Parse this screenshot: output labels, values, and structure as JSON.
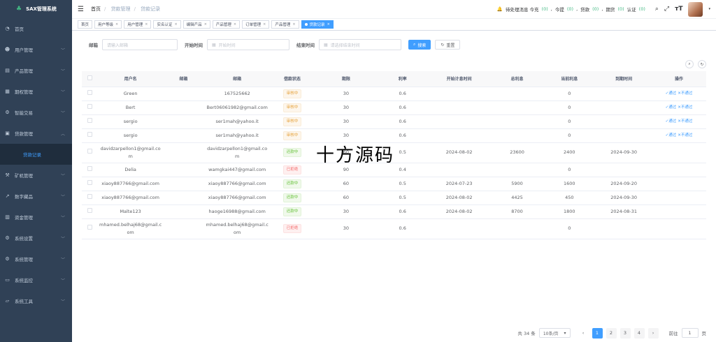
{
  "app": {
    "title": "SAX管理系统"
  },
  "sidebar": {
    "items": [
      {
        "label": "首页",
        "icon": "dashboard-icon",
        "glyph": "◔",
        "expandable": false
      },
      {
        "label": "用户管理",
        "icon": "user-icon",
        "glyph": "☻",
        "expandable": true
      },
      {
        "label": "产品管理",
        "icon": "document-icon",
        "glyph": "▤",
        "expandable": true
      },
      {
        "label": "期权管理",
        "icon": "chart-icon",
        "glyph": "▦",
        "expandable": true
      },
      {
        "label": "智能交易",
        "icon": "gear-icon",
        "glyph": "⚙",
        "expandable": true
      },
      {
        "label": "贷款管理",
        "icon": "cart-icon",
        "glyph": "▣",
        "expandable": true,
        "expanded": true
      },
      {
        "label": "贷款记录",
        "icon": "",
        "glyph": "",
        "expandable": false,
        "sub": true
      },
      {
        "label": "矿机管理",
        "icon": "tool-icon",
        "glyph": "⚒",
        "expandable": true
      },
      {
        "label": "数字藏品",
        "icon": "trend-icon",
        "glyph": "↗",
        "expandable": true
      },
      {
        "label": "资金管理",
        "icon": "wallet-icon",
        "glyph": "▥",
        "expandable": true
      },
      {
        "label": "系统设置",
        "icon": "settings-icon",
        "glyph": "⚙",
        "expandable": true
      },
      {
        "label": "系统管理",
        "icon": "system-icon",
        "glyph": "⚙",
        "expandable": true
      },
      {
        "label": "系统监控",
        "icon": "monitor-icon",
        "glyph": "▭",
        "expandable": true
      },
      {
        "label": "系统工具",
        "icon": "toolbox-icon",
        "glyph": "▱",
        "expandable": true
      }
    ]
  },
  "header": {
    "breadcrumb": [
      "首页",
      "贷款管理",
      "贷款记录"
    ],
    "pending_label": "待处理消息 今充",
    "counters": [
      {
        "label": "今充",
        "value": "(0)"
      },
      {
        "label": "今提",
        "value": "(0)"
      },
      {
        "label": "贷款",
        "value": "(0)"
      },
      {
        "label": "期货",
        "value": "(0)"
      },
      {
        "label": "认证",
        "value": "(0)"
      }
    ]
  },
  "tags": [
    {
      "label": "首页",
      "closable": false
    },
    {
      "label": "用户等级",
      "closable": true
    },
    {
      "label": "用户管理",
      "closable": true
    },
    {
      "label": "实名认证",
      "closable": true
    },
    {
      "label": "编辑产品",
      "closable": true
    },
    {
      "label": "产品管理",
      "closable": true
    },
    {
      "label": "订单管理",
      "closable": true
    },
    {
      "label": "产品管理",
      "closable": true
    },
    {
      "label": "贷款记录",
      "closable": true,
      "active": true
    }
  ],
  "search": {
    "email_label": "邮箱",
    "email_placeholder": "请输入邮箱",
    "start_label": "开始时间",
    "start_placeholder": "开始时间",
    "end_label": "结束时间",
    "end_placeholder": "请选择结束时间",
    "search_btn": "搜索",
    "reset_btn": "重置"
  },
  "table": {
    "columns": [
      "用户名",
      "邮箱",
      "邮箱",
      "借款状态",
      "期限",
      "利率",
      "开始计息时间",
      "总利息",
      "当前利息",
      "到期时间",
      "操作"
    ],
    "rows": [
      {
        "username": "Green",
        "email1": "",
        "email2": "167525662",
        "status": "审核中",
        "status_type": "warn",
        "term": "30",
        "rate": "0.6",
        "start": "",
        "total": "",
        "current": "0",
        "due": "",
        "op": true
      },
      {
        "username": "Bert",
        "email1": "",
        "email2": "Bert06061982@gmail.com",
        "status": "审核中",
        "status_type": "warn",
        "term": "30",
        "rate": "0.6",
        "start": "",
        "total": "",
        "current": "0",
        "due": "",
        "op": true
      },
      {
        "username": "sergio",
        "email1": "",
        "email2": "ser1mah@yahoo.it",
        "status": "审核中",
        "status_type": "warn",
        "term": "30",
        "rate": "0.6",
        "start": "",
        "total": "",
        "current": "0",
        "due": "",
        "op": true
      },
      {
        "username": "sergio",
        "email1": "",
        "email2": "ser1mah@yahoo.it",
        "status": "审核中",
        "status_type": "warn",
        "term": "30",
        "rate": "0.6",
        "start": "",
        "total": "",
        "current": "0",
        "due": "",
        "op": true
      },
      {
        "username": "davidzarpellon1@gmail.com",
        "email1": "",
        "email2": "davidzarpellon1@gmail.com",
        "status": "还款中",
        "status_type": "ok",
        "term": "60",
        "rate": "0.5",
        "start": "2024-08-02",
        "total": "23600",
        "current": "2400",
        "due": "2024-09-30",
        "op": false
      },
      {
        "username": "Delia",
        "email1": "",
        "email2": "wamgkai447@gmail.com",
        "status": "已拒绝",
        "status_type": "err",
        "term": "90",
        "rate": "0.4",
        "start": "",
        "total": "",
        "current": "0",
        "due": "",
        "op": false
      },
      {
        "username": "xiaoy887766@gmail.com",
        "email1": "",
        "email2": "xiaoy887766@gmail.com",
        "status": "还款中",
        "status_type": "ok",
        "term": "60",
        "rate": "0.5",
        "start": "2024-07-23",
        "total": "5900",
        "current": "1600",
        "due": "2024-09-20",
        "op": false
      },
      {
        "username": "xiaoy887766@gmail.com",
        "email1": "",
        "email2": "xiaoy887766@gmail.com",
        "status": "还款中",
        "status_type": "ok",
        "term": "60",
        "rate": "0.5",
        "start": "2024-08-02",
        "total": "4425",
        "current": "450",
        "due": "2024-09-30",
        "op": false
      },
      {
        "username": "Malte123",
        "email1": "",
        "email2": "haoge16988@gmail.com",
        "status": "还款中",
        "status_type": "ok",
        "term": "30",
        "rate": "0.6",
        "start": "2024-08-02",
        "total": "8700",
        "current": "1800",
        "due": "2024-08-31",
        "op": false
      },
      {
        "username": "mhamed.belhaj68@gmail.com",
        "email1": "",
        "email2": "mhamed.belhaj68@gmail.com",
        "status": "已拒绝",
        "status_type": "err",
        "term": "30",
        "rate": "0.6",
        "start": "",
        "total": "",
        "current": "0",
        "due": "",
        "op": false
      }
    ],
    "op_pass": "✓通过",
    "op_reject": "✕不通过"
  },
  "pagination": {
    "total": "共 34 条",
    "page_size": "10条/页",
    "pages": [
      "1",
      "2",
      "3",
      "4"
    ],
    "current": "1",
    "goto_label": "前往",
    "goto_value": "1",
    "page_suffix": "页"
  },
  "watermark": "十方源码"
}
